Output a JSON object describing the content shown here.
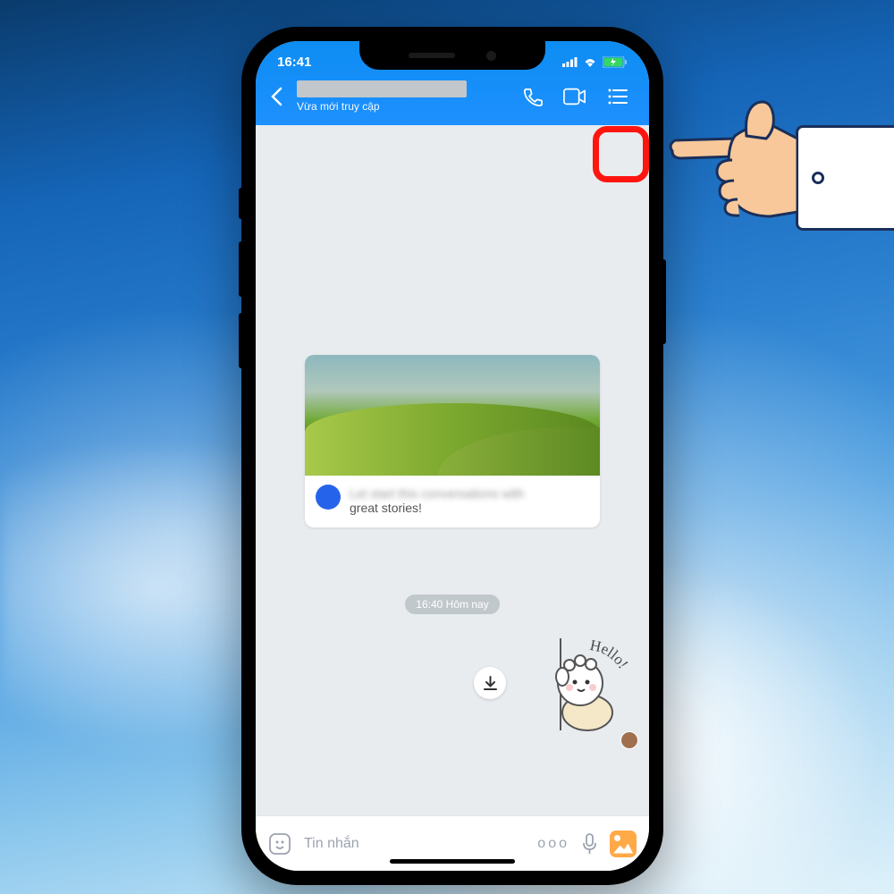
{
  "status_bar": {
    "time": "16:41"
  },
  "header": {
    "status_text": "Vừa mới truy cập"
  },
  "card": {
    "line1_blurred": "Let start this conversations with",
    "line2": "great stories!"
  },
  "timestamp": "16:40 Hôm nay",
  "sticker": {
    "bubble_text": "Hello!"
  },
  "input": {
    "placeholder": "Tin nhắn",
    "more_dots": "ooo"
  }
}
